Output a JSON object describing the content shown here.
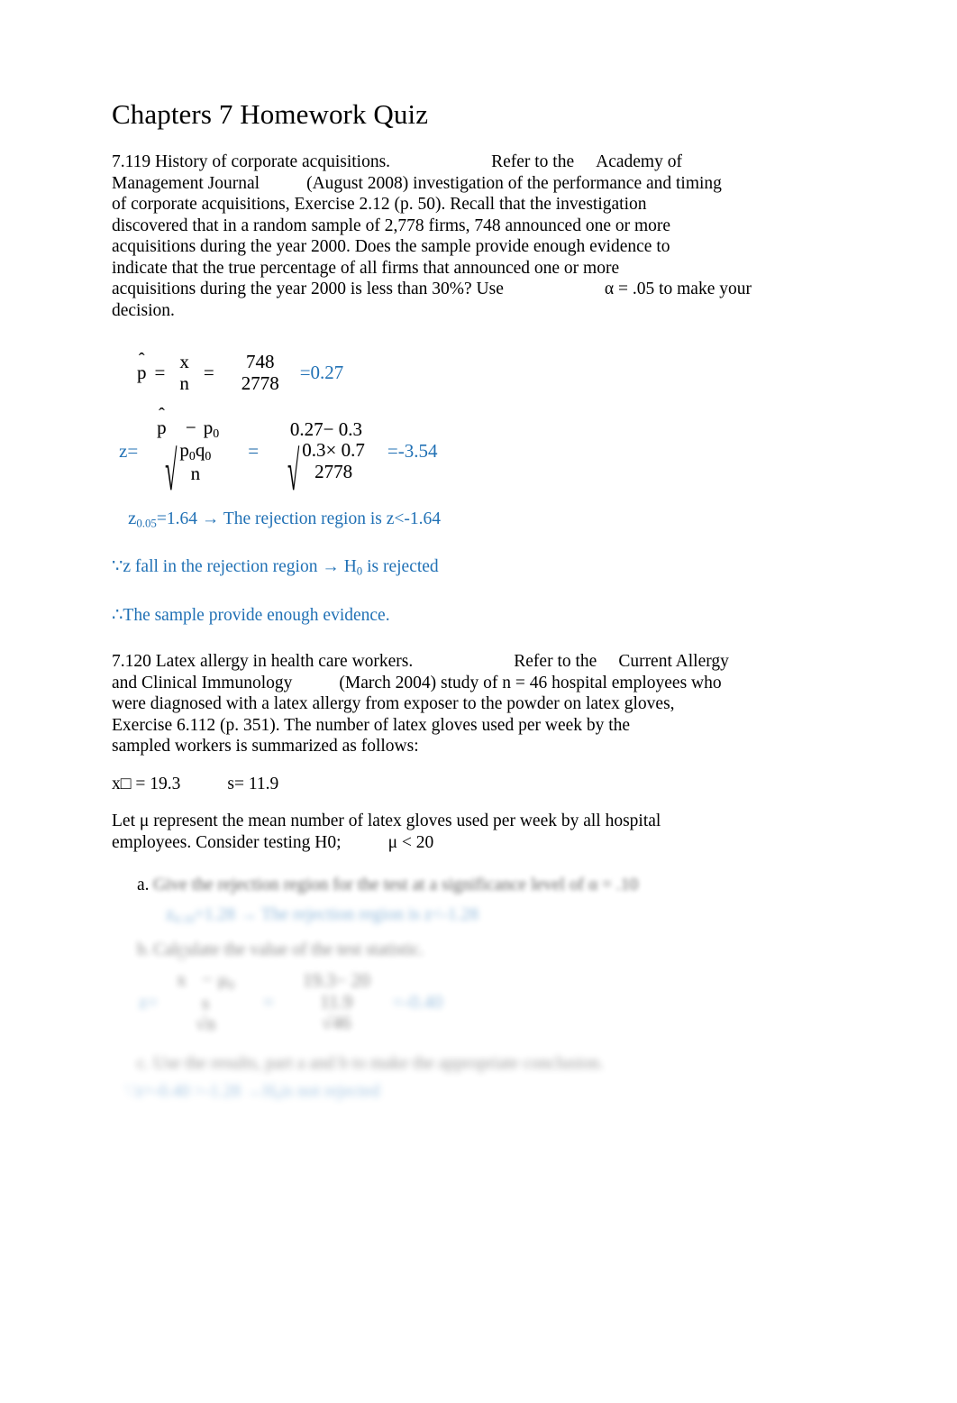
{
  "document": {
    "title": "Chapters 7 Homework Quiz",
    "accent_color": "#2171b5",
    "text_color": "#000000",
    "background_color": "#ffffff"
  },
  "problem_7119": {
    "number_and_title": "7.119 History of corporate acquisitions.",
    "refer_lead": "Refer to the",
    "journal_name_part1": "Academy of",
    "journal_name_part2": "Management Journal",
    "line2_rest": "(August 2008) investigation of the performance and timing",
    "line3": "of corporate acquisitions, Exercise 2.12 (p. 50). Recall that the investigation",
    "line4": "discovered that in a random sample of 2,778 firms, 748 announced one or more",
    "line5": "acquisitions during the year 2000. Does the sample provide enough evidence to",
    "line6": "indicate that the true percentage of all firms that announced one or more",
    "line7_a": "acquisitions during the year 2000 is less than 30%? Use",
    "line7_b": "α = .05 to make your",
    "line8": "decision.",
    "eq_phat": {
      "lhs_symbol": "p",
      "lhs_hat": "ˆ",
      "eq1": "=",
      "frac1_num": "x",
      "frac1_den": "n",
      "eq2": "=",
      "frac2_num": "748",
      "frac2_den": "2778",
      "result": "=0.27"
    },
    "eq_z": {
      "lhs": "z=",
      "num_phat": "p",
      "num_hat": "ˆ",
      "num_minus": "−",
      "num_p0": "p",
      "num_p0_sub": "0",
      "den_radical": "√",
      "den_num_p0": "p",
      "den_num_p0_sub": "0",
      "den_num_q0": "q",
      "den_num_q0_sub": "0",
      "den_den": "n",
      "eq_mid": "=",
      "r_num": "0.27− 0.3",
      "r_den_top": "0.3× 0.7",
      "r_den_bottom": "2778",
      "result": "=-3.54"
    },
    "critical_value": {
      "z_symbol": "z",
      "z_subscript": "0.05",
      "statement": "=1.64 → The rejection region is z<-1.64"
    },
    "conclusion_line1_a": "∵z fall in the rejection region → H",
    "conclusion_line1_sub": "0",
    "conclusion_line1_b": "is rejected",
    "conclusion_line2": "∴The sample provide enough evidence."
  },
  "problem_7120": {
    "number_and_title": "7.120 Latex allergy in health care workers.",
    "refer_lead": "Refer to the",
    "journal_name_part1": "Current Allergy",
    "journal_name_part2": "and Clinical Immunology",
    "line2_rest": "(March 2004) study of n = 46 hospital employees who",
    "line3": "were diagnosed with a latex allergy from exposer to the powder on latex gloves,",
    "line4": "Exercise 6.112 (p. 351). The number of latex gloves used per week by the",
    "line5": "sampled workers is summarized as follows:",
    "stats_line_mean": "x□ = 19.3",
    "stats_line_sd": "s= 11.9",
    "let_line1": "Let  μ represent the mean number of latex gloves used per week by all hospital",
    "let_line2_a": "employees. Consider testing H0;",
    "let_line2_b": "μ < 20",
    "items": [
      {
        "marker": "a.",
        "text": "Give the rejection region for the test at a significance level of α = .10"
      },
      {
        "marker": "b.",
        "text": "Calculate the value of the test statistic."
      },
      {
        "marker": "c.",
        "text": "Use the results, part a and b to make the appropriate conclusion."
      }
    ],
    "answer_a": {
      "z_symbol": "z",
      "z_subscript": "0.10",
      "statement": "=1.28 → The rejection region is z<-1.28"
    },
    "answer_b_eq": {
      "lhs": "z=",
      "num_x": "x",
      "num_hat": "¯",
      "num_minus": "−",
      "num_mu": "μ",
      "num_mu_sub": "0",
      "den_s": "s",
      "den_radical": "√",
      "den_n": "n",
      "eq_mid": "=",
      "r_num": "19.3− 20",
      "r_den_top": "11.9",
      "r_den_bottom": "46",
      "result": "=-0.40"
    },
    "answer_c_a": "∵z=-0.40 >",
    "answer_c_b": "-1.28 →",
    "answer_c_sub": "0",
    "answer_c_c": "H",
    "answer_c_d": "is not rejected"
  }
}
